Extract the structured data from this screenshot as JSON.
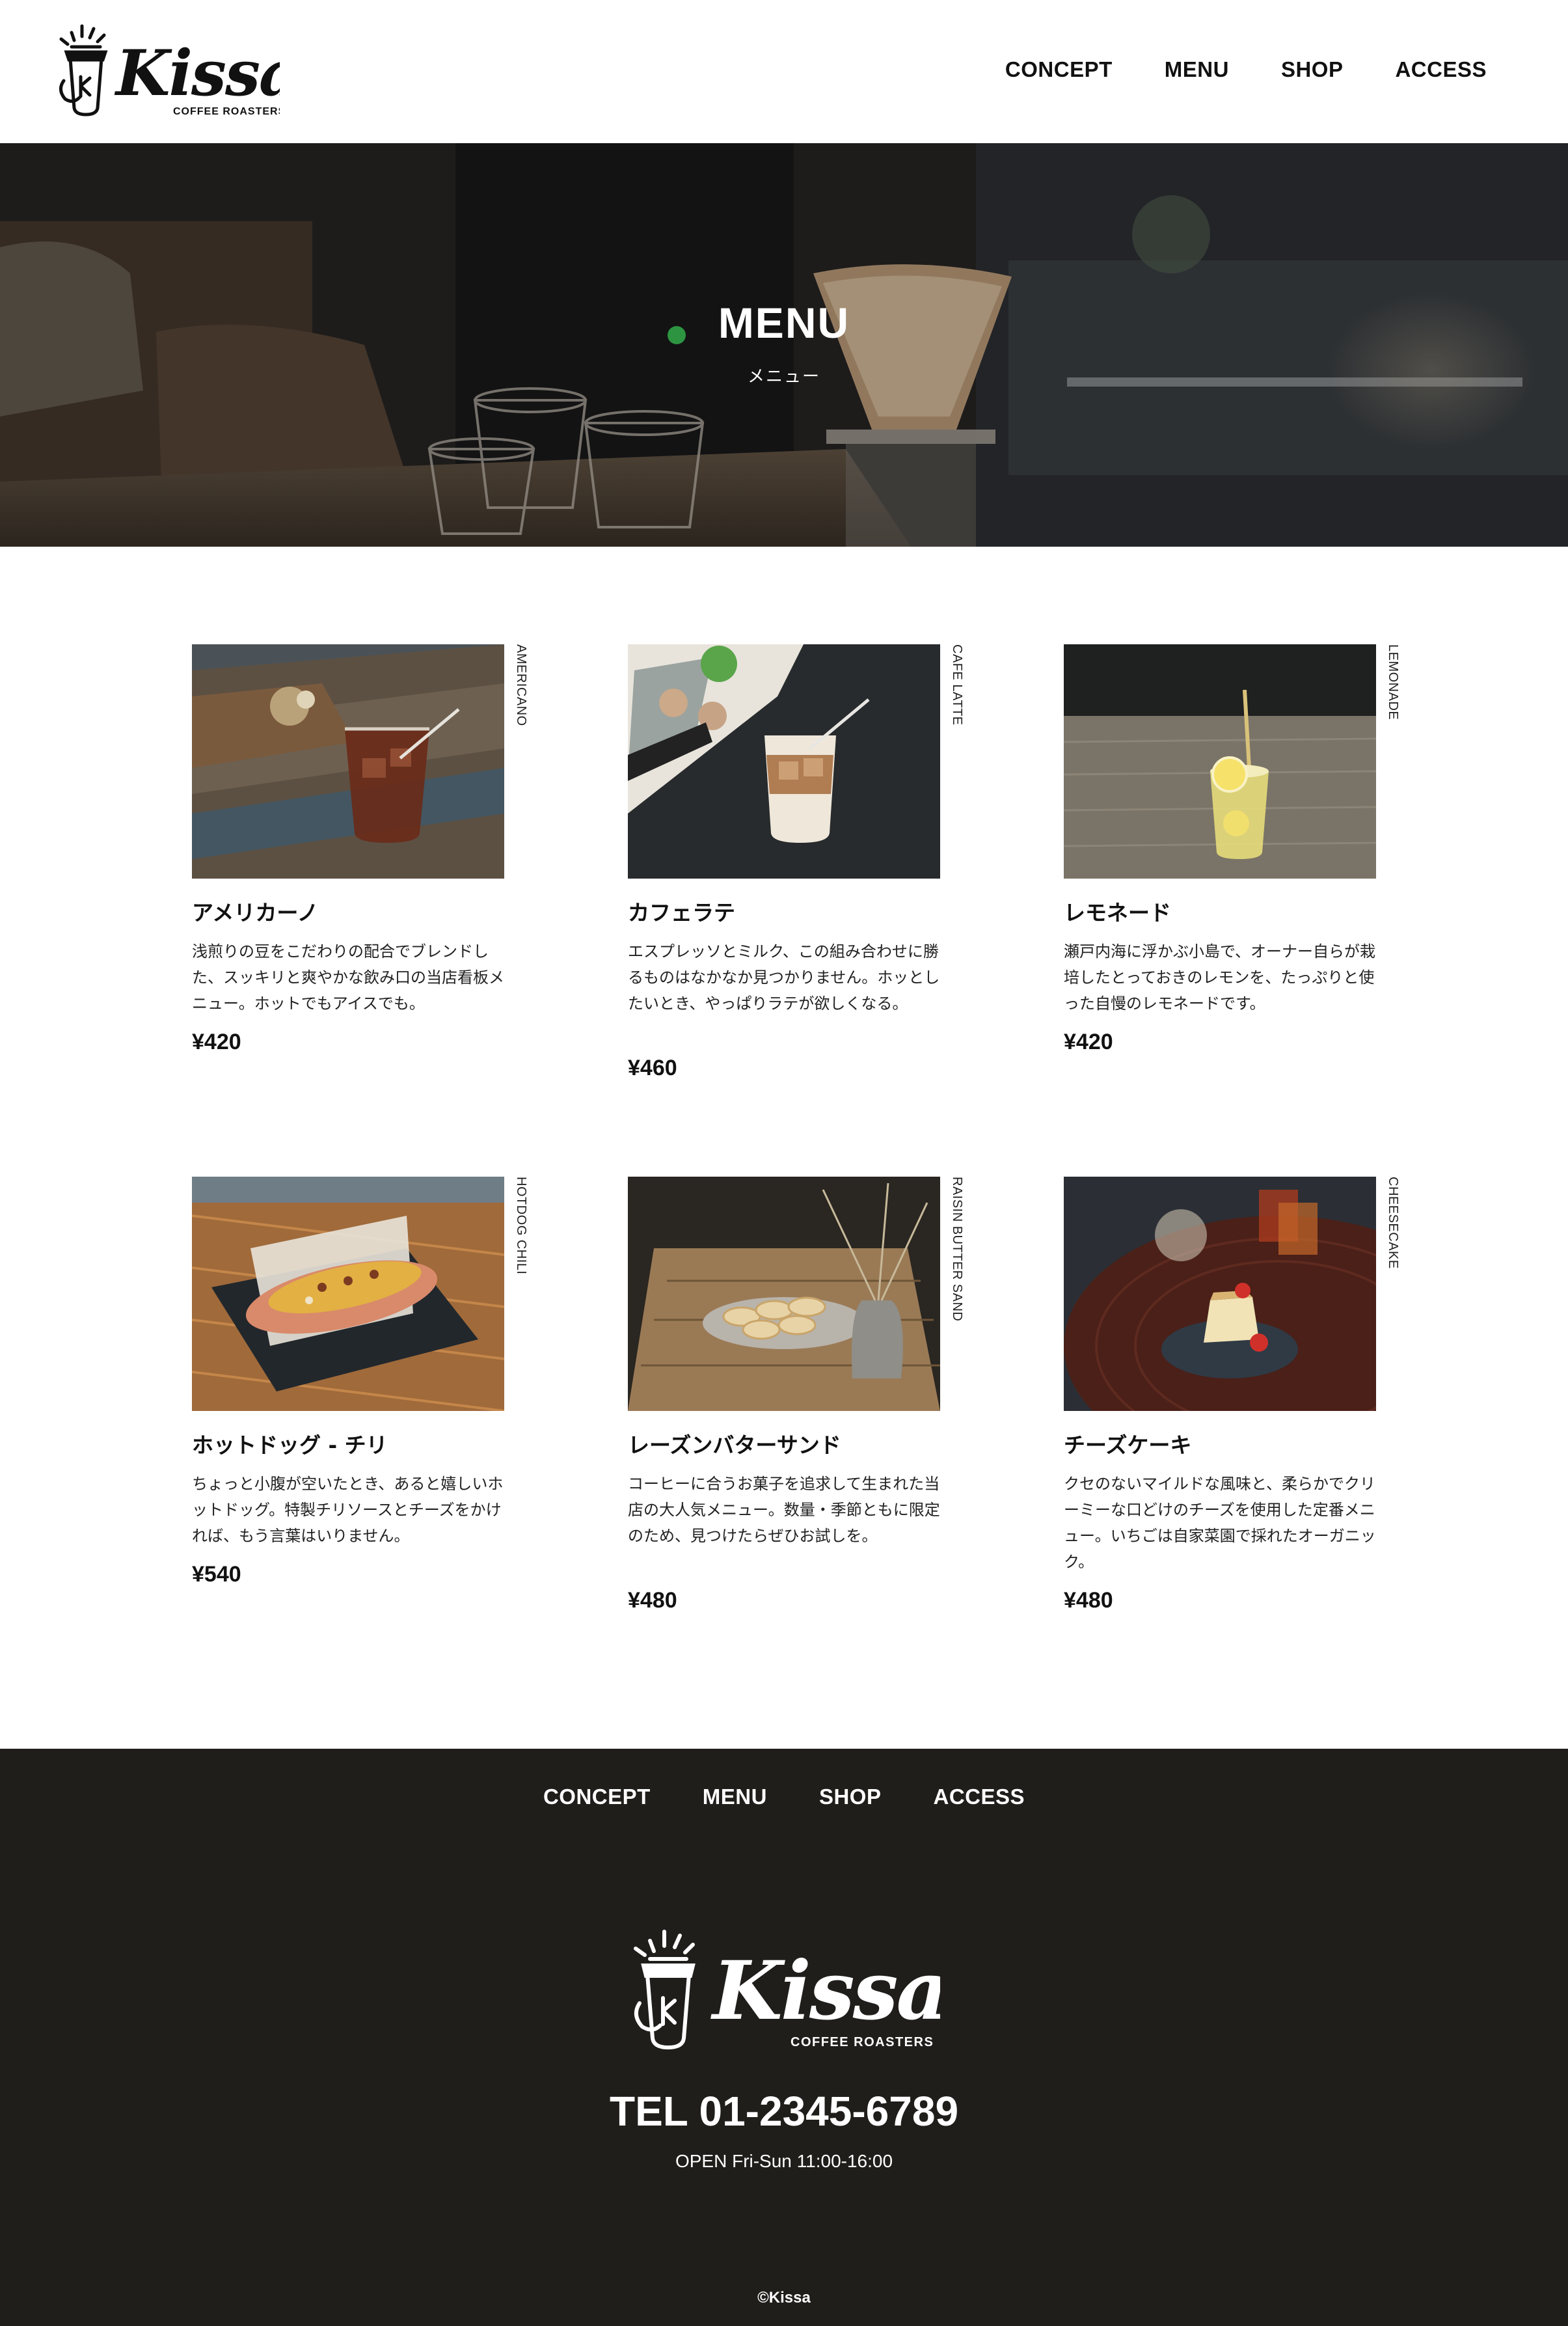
{
  "brand": {
    "logo_name": "Kissa",
    "logo_tagline": "COFFEE ROASTERS"
  },
  "nav": [
    "CONCEPT",
    "MENU",
    "SHOP",
    "ACCESS"
  ],
  "hero": {
    "title": "MENU",
    "subtitle": "メニュー"
  },
  "menu_items": [
    {
      "label": "AMERICANO",
      "name": "アメリカーノ",
      "description": "浅煎りの豆をこだわりの配合でブレンドした、スッキリと爽やかな飲み口の当店看板メニュー。ホットでもアイスでも。",
      "price": "¥420"
    },
    {
      "label": "CAFE LATTE",
      "name": "カフェラテ",
      "description": "エスプレッソとミルク、この組み合わせに勝るものはなかなか見つかりません。ホッとしたいとき、やっぱりラテが欲しくなる。",
      "price": "¥460"
    },
    {
      "label": "LEMONADE",
      "name": "レモネード",
      "description": "瀬戸内海に浮かぶ小島で、オーナー自らが栽培したとっておきのレモンを、たっぷりと使った自慢のレモネードです。",
      "price": "¥420"
    },
    {
      "label": "HOTDOG CHILI",
      "name": "ホットドッグ - チリ",
      "description": "ちょっと小腹が空いたとき、あると嬉しいホットドッグ。特製チリソースとチーズをかければ、もう言葉はいりません。",
      "price": "¥540"
    },
    {
      "label": "RAISIN BUTTER SAND",
      "name": "レーズンバターサンド",
      "description": "コーヒーに合うお菓子を追求して生まれた当店の大人気メニュー。数量・季節ともに限定のため、見つけたらぜひお試しを。",
      "price": "¥480"
    },
    {
      "label": "CHEESECAKE",
      "name": "チーズケーキ",
      "description": "クセのないマイルドな風味と、柔らかでクリーミーな口どけのチーズを使用した定番メニュー。いちごは自家菜園で採れたオーガニック。",
      "price": "¥480"
    }
  ],
  "footer": {
    "tel": "TEL 01-2345-6789",
    "open": "OPEN Fri-Sun 11:00-16:00",
    "copyright": "©Kissa"
  },
  "colors": {
    "footer_bg": "#1f1e1b",
    "text": "#111111",
    "white": "#ffffff"
  }
}
